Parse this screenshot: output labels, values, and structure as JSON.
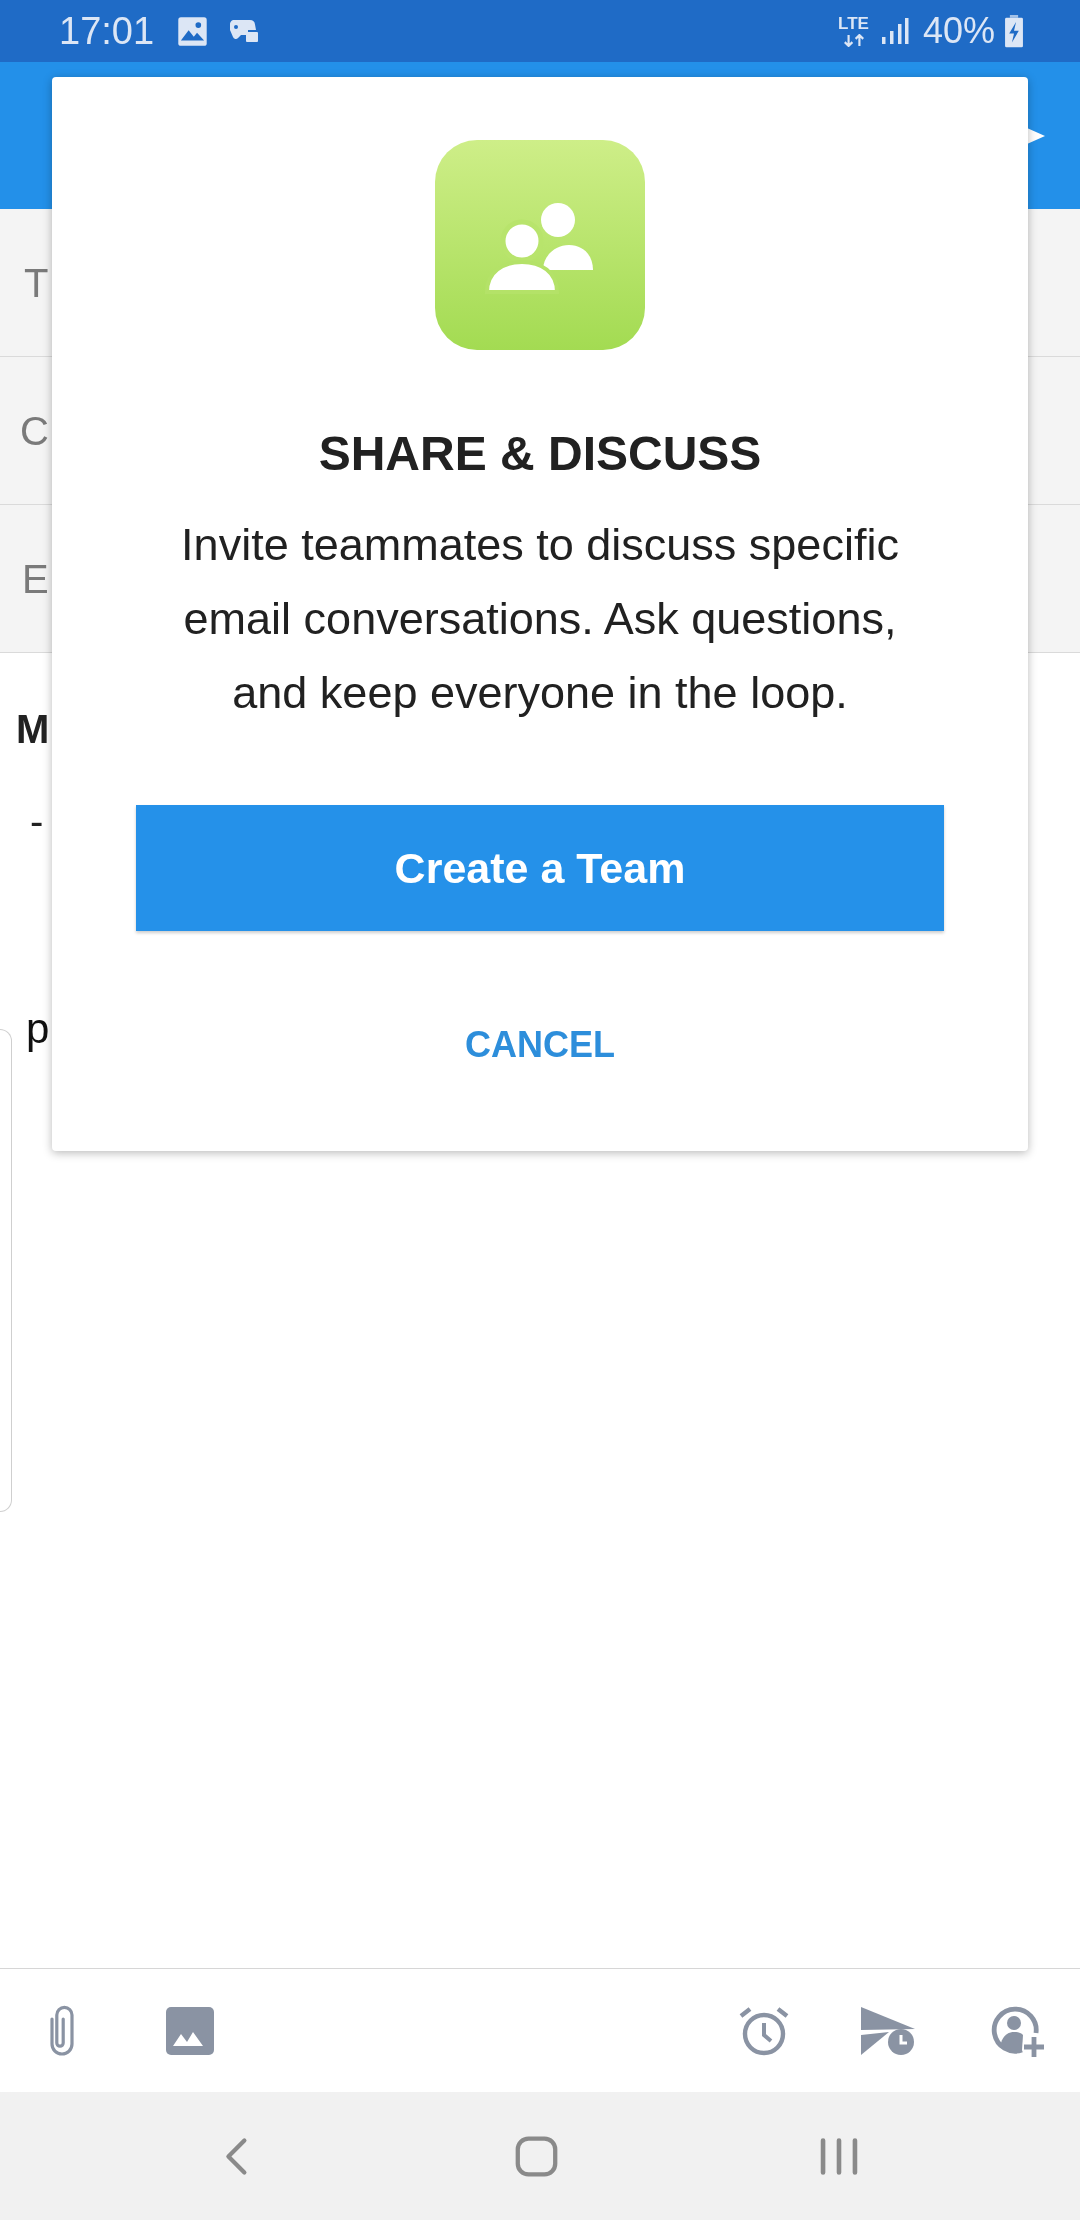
{
  "status_bar": {
    "time": "17:01",
    "network": "LTE",
    "battery": "40%"
  },
  "compose": {
    "fields": [
      "T",
      "C",
      "E"
    ],
    "body": [
      {
        "text": "M",
        "bold": true
      },
      {
        "text": "-",
        "bold": false
      }
    ],
    "card_row": {
      "text": "p"
    }
  },
  "dialog": {
    "title": "SHARE & DISCUSS",
    "message": "Invite teammates to discuss specific email conversations. Ask questions, and keep everyone in the loop.",
    "primary_button": "Create a Team",
    "cancel_button": "CANCEL"
  }
}
